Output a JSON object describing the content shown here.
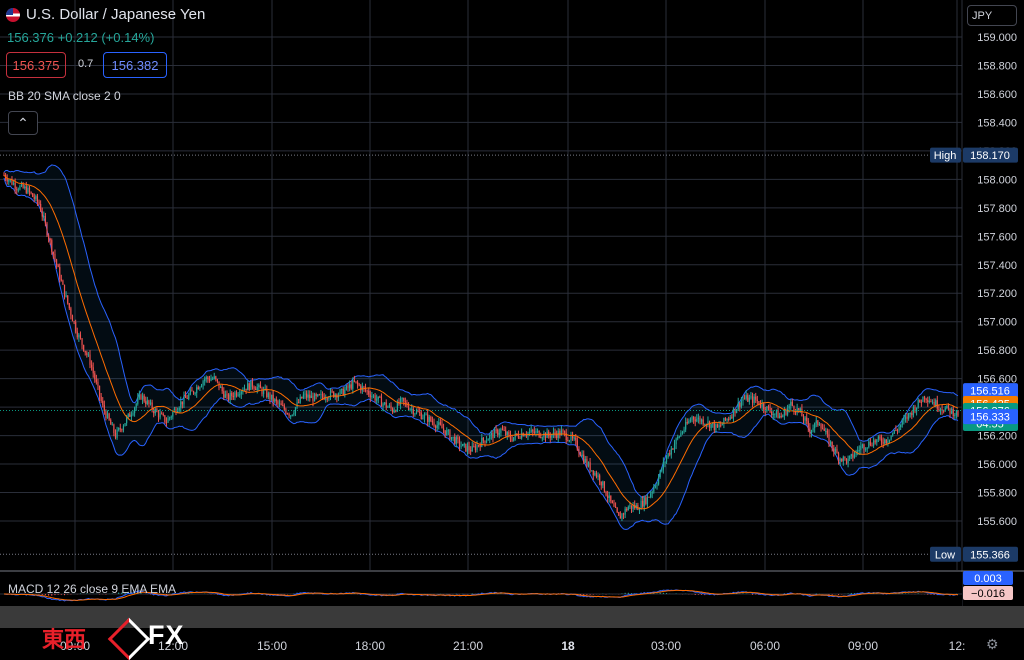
{
  "header": {
    "title": "U.S. Dollar / Japanese Yen",
    "quote": "156.376 +0.212 (+0.14%)",
    "sell_price": "156.375",
    "spread": "0.7",
    "buy_price": "156.382",
    "bb_label": "BB 20 SMA close 2 0",
    "macd_label": "MACD 12 26 close 9 EMA EMA",
    "currency": "JPY",
    "collapse": "⌃"
  },
  "logo": {
    "kanji": "東西",
    "fx": "FX"
  },
  "icons": {
    "settings": "gear-icon",
    "flag": "us-flag-icon",
    "collapse": "chevron-up-icon"
  },
  "chart_data": {
    "type": "candlestick",
    "symbol": "USD/JPY",
    "ylim": [
      155.366,
      159.09
    ],
    "y_ticks": [
      "159.000",
      "158.800",
      "158.600",
      "158.400",
      "158.200",
      "158.000",
      "157.800",
      "157.600",
      "157.400",
      "157.200",
      "157.000",
      "156.800",
      "156.600",
      "156.400",
      "156.200",
      "156.000",
      "155.800",
      "155.600"
    ],
    "x_ticks": [
      {
        "label": "09:00",
        "x": 75
      },
      {
        "label": "12:00",
        "x": 173
      },
      {
        "label": "15:00",
        "x": 272
      },
      {
        "label": "18:00",
        "x": 370
      },
      {
        "label": "21:00",
        "x": 468
      },
      {
        "label": "18",
        "x": 568
      },
      {
        "label": "03:00",
        "x": 666
      },
      {
        "label": "06:00",
        "x": 765
      },
      {
        "label": "09:00",
        "x": 863
      },
      {
        "label": "12:",
        "x": 957
      }
    ],
    "price_tags": [
      {
        "label": "High",
        "value": "158.170",
        "y": 158.17,
        "color": "#1c3a66",
        "dotted": true
      },
      {
        "value": "156.516",
        "y": 156.516,
        "color": "#2962ff"
      },
      {
        "value": "156.425",
        "y": 156.425,
        "color": "#f57c00"
      },
      {
        "value": "156.376",
        "sub": "04:55",
        "y": 156.376,
        "color": "#089981",
        "dotted": true
      },
      {
        "value": "156.333",
        "y": 156.333,
        "color": "#2962ff"
      },
      {
        "label": "Low",
        "value": "155.366",
        "y": 155.366,
        "color": "#1c3a66",
        "dotted": true
      }
    ],
    "macd_tags": [
      {
        "value": "0.003",
        "color": "#2962ff"
      },
      {
        "value": "−0.016",
        "color": "#f5c6c6",
        "text": "#000"
      }
    ],
    "close_keypoints": [
      [
        0,
        158.03
      ],
      [
        8,
        157.95
      ],
      [
        14,
        157.93
      ],
      [
        22,
        157.83
      ],
      [
        30,
        157.52
      ],
      [
        38,
        157.2
      ],
      [
        46,
        156.92
      ],
      [
        54,
        156.72
      ],
      [
        62,
        156.4
      ],
      [
        70,
        156.2
      ],
      [
        78,
        156.33
      ],
      [
        86,
        156.48
      ],
      [
        94,
        156.38
      ],
      [
        102,
        156.3
      ],
      [
        110,
        156.42
      ],
      [
        118,
        156.5
      ],
      [
        126,
        156.6
      ],
      [
        132,
        156.6
      ],
      [
        140,
        156.46
      ],
      [
        148,
        156.52
      ],
      [
        156,
        156.56
      ],
      [
        164,
        156.5
      ],
      [
        172,
        156.42
      ],
      [
        180,
        156.35
      ],
      [
        188,
        156.48
      ],
      [
        196,
        156.46
      ],
      [
        204,
        156.49
      ],
      [
        212,
        156.5
      ],
      [
        220,
        156.57
      ],
      [
        228,
        156.51
      ],
      [
        236,
        156.44
      ],
      [
        244,
        156.38
      ],
      [
        250,
        156.44
      ],
      [
        258,
        156.37
      ],
      [
        266,
        156.32
      ],
      [
        274,
        156.26
      ],
      [
        282,
        156.18
      ],
      [
        288,
        156.12
      ],
      [
        294,
        156.1
      ],
      [
        300,
        156.16
      ],
      [
        306,
        156.2
      ],
      [
        312,
        156.24
      ],
      [
        318,
        156.18
      ],
      [
        326,
        156.22
      ],
      [
        334,
        156.22
      ],
      [
        342,
        156.2
      ],
      [
        350,
        156.22
      ],
      [
        358,
        156.16
      ],
      [
        366,
        156.0
      ],
      [
        374,
        155.9
      ],
      [
        380,
        155.75
      ],
      [
        386,
        155.62
      ],
      [
        392,
        155.7
      ],
      [
        398,
        155.7
      ],
      [
        404,
        155.76
      ],
      [
        410,
        155.88
      ],
      [
        416,
        156.05
      ],
      [
        424,
        156.2
      ],
      [
        432,
        156.33
      ],
      [
        440,
        156.3
      ],
      [
        448,
        156.25
      ],
      [
        456,
        156.34
      ],
      [
        464,
        156.46
      ],
      [
        472,
        156.45
      ],
      [
        480,
        156.38
      ],
      [
        488,
        156.33
      ],
      [
        494,
        156.42
      ],
      [
        500,
        156.36
      ],
      [
        506,
        156.24
      ],
      [
        512,
        156.3
      ],
      [
        518,
        156.16
      ],
      [
        524,
        156.05
      ],
      [
        530,
        156.02
      ],
      [
        538,
        156.12
      ],
      [
        546,
        156.16
      ],
      [
        554,
        156.17
      ],
      [
        562,
        156.26
      ],
      [
        570,
        156.37
      ],
      [
        578,
        156.48
      ],
      [
        588,
        156.4
      ],
      [
        600,
        156.35
      ]
    ],
    "candles_count": 600
  }
}
